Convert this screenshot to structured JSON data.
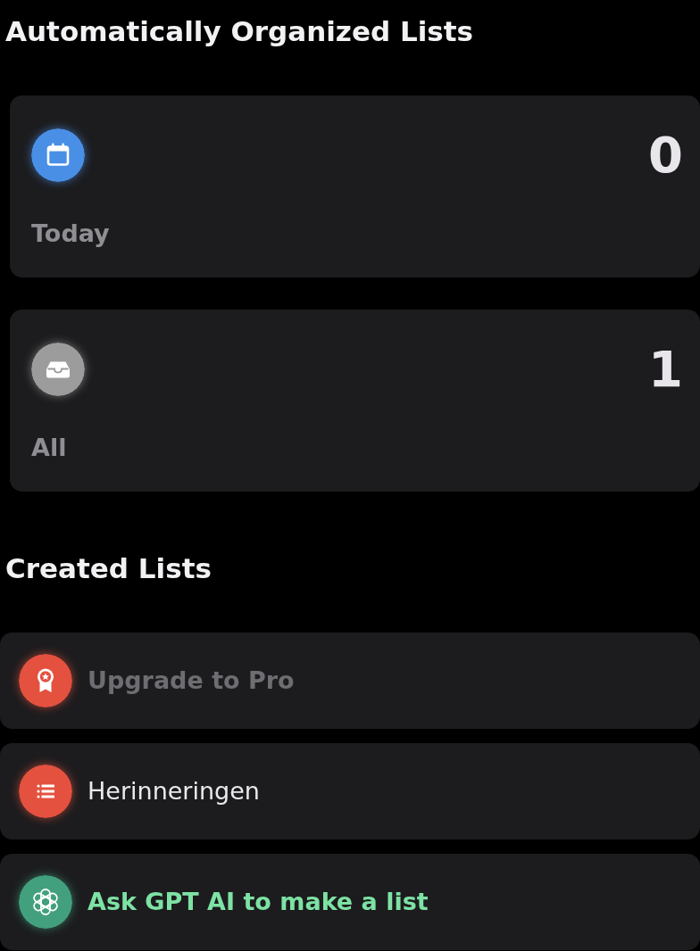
{
  "smart_lists": {
    "title": "Automatically Organized Lists",
    "cards": [
      {
        "kind": "today",
        "label": "Today",
        "count": "0",
        "color": "#4a8fe6"
      },
      {
        "kind": "all",
        "label": "All",
        "count": "1",
        "color": "#9c9c9c"
      }
    ]
  },
  "created_lists": {
    "title": "Created Lists",
    "rows": [
      {
        "kind": "upgrade",
        "label": "Upgrade to Pro",
        "color": "#e4513f"
      },
      {
        "kind": "list",
        "label": "Herinneringen",
        "color": "#e4513f"
      },
      {
        "kind": "assistant",
        "label": "Ask GPT AI to make a list",
        "color": "#42a07e"
      }
    ]
  }
}
